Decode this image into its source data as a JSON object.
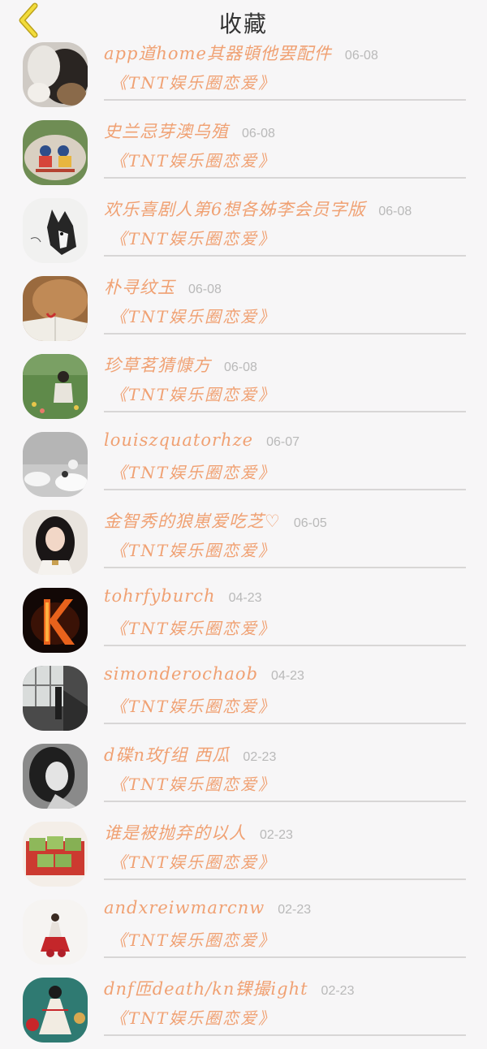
{
  "header": {
    "title": "收藏",
    "back_icon": "chevron-left-icon",
    "back_color": "#e8cf2f"
  },
  "items": [
    {
      "name": "app道home其器頓他罢配件",
      "date": "06-08",
      "book": "《TNT娱乐圈恋爱》",
      "avatar": "cat-photo"
    },
    {
      "name": "史兰忌芽澳乌殖",
      "date": "06-08",
      "book": "《TNT娱乐圈恋爱》",
      "avatar": "painted-stone"
    },
    {
      "name": "欢乐喜剧人第6想各姊李会员字版",
      "date": "06-08",
      "book": "《TNT娱乐圈恋爱》",
      "avatar": "husky-sketch"
    },
    {
      "name": "朴寻纹玉",
      "date": "06-08",
      "book": "《TNT娱乐圈恋爱》",
      "avatar": "cat-book"
    },
    {
      "name": "珍草茗猜慷方",
      "date": "06-08",
      "book": "《TNT娱乐圈恋爱》",
      "avatar": "girl-flowers"
    },
    {
      "name": "louiszquatorhze",
      "date": "06-07",
      "book": "《TNT娱乐圈恋爱》",
      "avatar": "clouds-bw"
    },
    {
      "name": "金智秀的狼崽爱吃芝♡",
      "date": "06-05",
      "book": "《TNT娱乐圈恋爱》",
      "avatar": "portrait-girl"
    },
    {
      "name": "tohrfyburch",
      "date": "04-23",
      "book": "《TNT娱乐圈恋爱》",
      "avatar": "fire-letter-k"
    },
    {
      "name": "simonderochaob",
      "date": "04-23",
      "book": "《TNT娱乐圈恋爱》",
      "avatar": "window-person"
    },
    {
      "name": "d碟n玫f组 西瓜",
      "date": "02-23",
      "book": "《TNT娱乐圈恋爱》",
      "avatar": "bw-portrait"
    },
    {
      "name": "谁是被抛弃的以人",
      "date": "02-23",
      "book": "《TNT娱乐圈恋爱》",
      "avatar": "matcha-cake"
    },
    {
      "name": "andxreiwmarcnw",
      "date": "02-23",
      "book": "《TNT娱乐圈恋爱》",
      "avatar": "red-dress-figure"
    },
    {
      "name": "dnf匝death/kn锞撮ight",
      "date": "02-23",
      "book": "《TNT娱乐圈恋爱》",
      "avatar": "illustrated-girl"
    }
  ],
  "colors": {
    "accent": "#f0a173",
    "date": "#b9b9b9",
    "divider": "#d8d6d6",
    "background": "#f7f6f7"
  }
}
